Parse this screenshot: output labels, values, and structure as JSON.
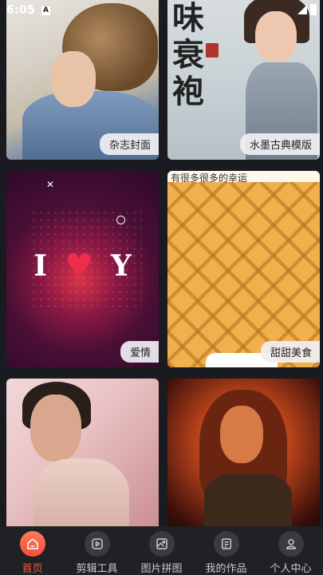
{
  "status_bar": {
    "time": "6:05",
    "notification_glyph": "A"
  },
  "cards": [
    {
      "label": "杂志封面"
    },
    {
      "label": "水墨古典模版",
      "overlay_text": "味 衰 袍"
    },
    {
      "label": "爱情",
      "art_left": "I",
      "art_right": "Y"
    },
    {
      "label": "甜甜美食",
      "banner_text": "有很多很多的幸运"
    },
    {
      "label": ""
    },
    {
      "label": ""
    }
  ],
  "tabs": [
    {
      "label": "首页",
      "icon": "home-icon",
      "active": true
    },
    {
      "label": "剪辑工具",
      "icon": "play-icon",
      "active": false
    },
    {
      "label": "图片拼图",
      "icon": "image-icon",
      "active": false
    },
    {
      "label": "我的作品",
      "icon": "document-icon",
      "active": false
    },
    {
      "label": "个人中心",
      "icon": "user-icon",
      "active": false
    }
  ],
  "colors": {
    "accent": "#f3593f",
    "background": "#1a1b20",
    "tabbar": "#202125"
  }
}
